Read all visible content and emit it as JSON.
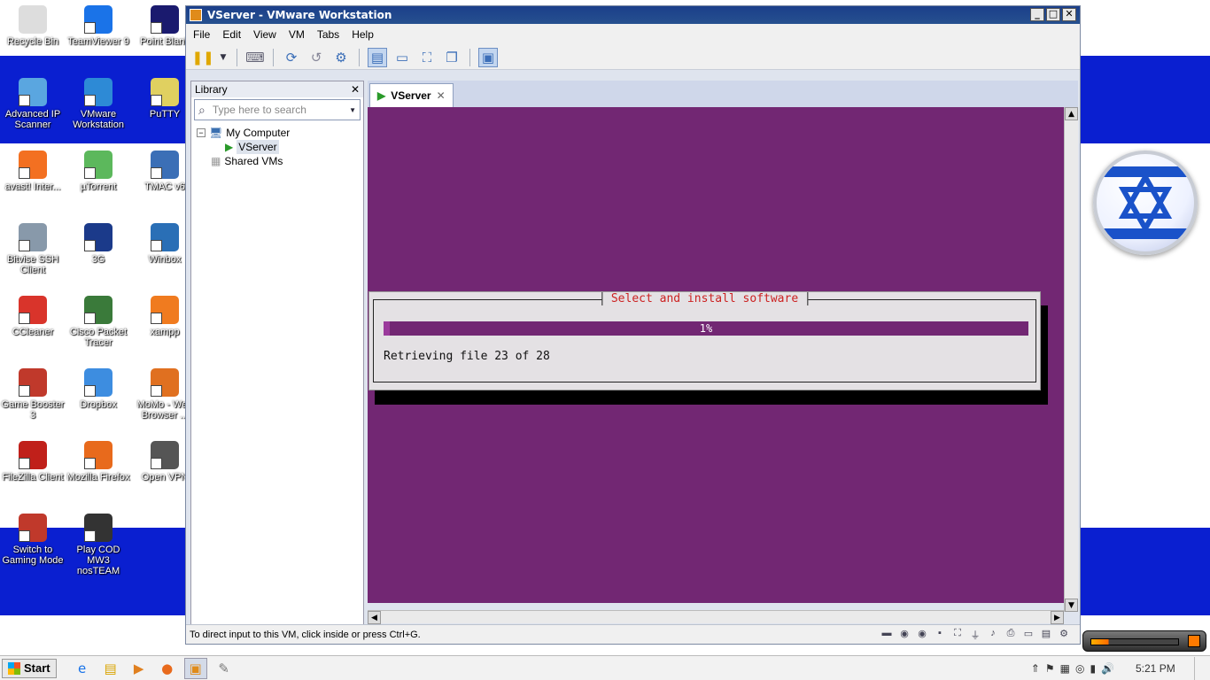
{
  "desktop": {
    "icons": [
      {
        "label": "Recycle Bin",
        "icon": "recycle-bin-icon",
        "color": "#dddddd"
      },
      {
        "label": "TeamViewer 9",
        "icon": "teamviewer-icon",
        "color": "#1a73e8"
      },
      {
        "label": "Point Blank",
        "icon": "point-blank-icon",
        "color": "#1a1a6e"
      },
      {
        "label": "Advanced IP Scanner",
        "icon": "advanced-ip-scanner-icon",
        "color": "#5aa6e0"
      },
      {
        "label": "VMware Workstation",
        "icon": "vmware-icon",
        "color": "#2d8ad6"
      },
      {
        "label": "PuTTY",
        "icon": "putty-icon",
        "color": "#e0d060"
      },
      {
        "label": "avast! Inter...",
        "icon": "avast-icon",
        "color": "#f37021"
      },
      {
        "label": "µTorrent",
        "icon": "utorrent-icon",
        "color": "#5cb85c"
      },
      {
        "label": "TMAC v6",
        "icon": "tmac-icon",
        "color": "#3b6fb6"
      },
      {
        "label": "Bitvise SSH Client",
        "icon": "bitvise-icon",
        "color": "#8899aa"
      },
      {
        "label": "3G",
        "icon": "3g-icon",
        "color": "#1b3a8a"
      },
      {
        "label": "Winbox",
        "icon": "winbox-icon",
        "color": "#2a6fb6"
      },
      {
        "label": "CCleaner",
        "icon": "ccleaner-icon",
        "color": "#d9342b"
      },
      {
        "label": "Cisco Packet Tracer",
        "icon": "cisco-packet-tracer-icon",
        "color": "#3a7a3a"
      },
      {
        "label": "xampp",
        "icon": "xampp-icon",
        "color": "#f07b1f"
      },
      {
        "label": "Game Booster 3",
        "icon": "game-booster-icon",
        "color": "#c0392b"
      },
      {
        "label": "Dropbox",
        "icon": "dropbox-icon",
        "color": "#3d8de0"
      },
      {
        "label": "MoMo - Web Browser ...",
        "icon": "momo-browser-icon",
        "color": "#e07020"
      },
      {
        "label": "FileZilla Client",
        "icon": "filezilla-icon",
        "color": "#c0201a"
      },
      {
        "label": "Mozilla Firefox",
        "icon": "firefox-icon",
        "color": "#e86a1c"
      },
      {
        "label": "Open VPN",
        "icon": "openvpn-icon",
        "color": "#555555"
      },
      {
        "label": "Switch to Gaming Mode",
        "icon": "gaming-mode-icon",
        "color": "#c0392b"
      },
      {
        "label": "Play COD MW3 nosTEAM",
        "icon": "cod-mw3-icon",
        "color": "#333333"
      }
    ]
  },
  "window": {
    "title": "VServer - VMware Workstation",
    "menu": [
      "File",
      "Edit",
      "View",
      "VM",
      "Tabs",
      "Help"
    ],
    "library": {
      "title": "Library",
      "close": "✕",
      "search_placeholder": "Type here to search",
      "tree": {
        "root": "My Computer",
        "vm": "VServer",
        "shared": "Shared VMs"
      }
    },
    "tab": {
      "label": "VServer",
      "close": "✕"
    },
    "installer": {
      "title": "Select and install software",
      "progress_text": "1%",
      "progress_value": 0.01,
      "message": "Retrieving file 23 of 28"
    },
    "status": "To direct input to this VM, click inside or press Ctrl+G."
  },
  "taskbar": {
    "start": "Start",
    "time": "5:21 PM"
  },
  "colors": {
    "console_bg": "#722773",
    "dialog_bg": "#e4e1e4",
    "dialog_title": "#cc2222",
    "wallpaper_blue": "#0a1fd0",
    "titlebar": "#1b3f8a"
  }
}
